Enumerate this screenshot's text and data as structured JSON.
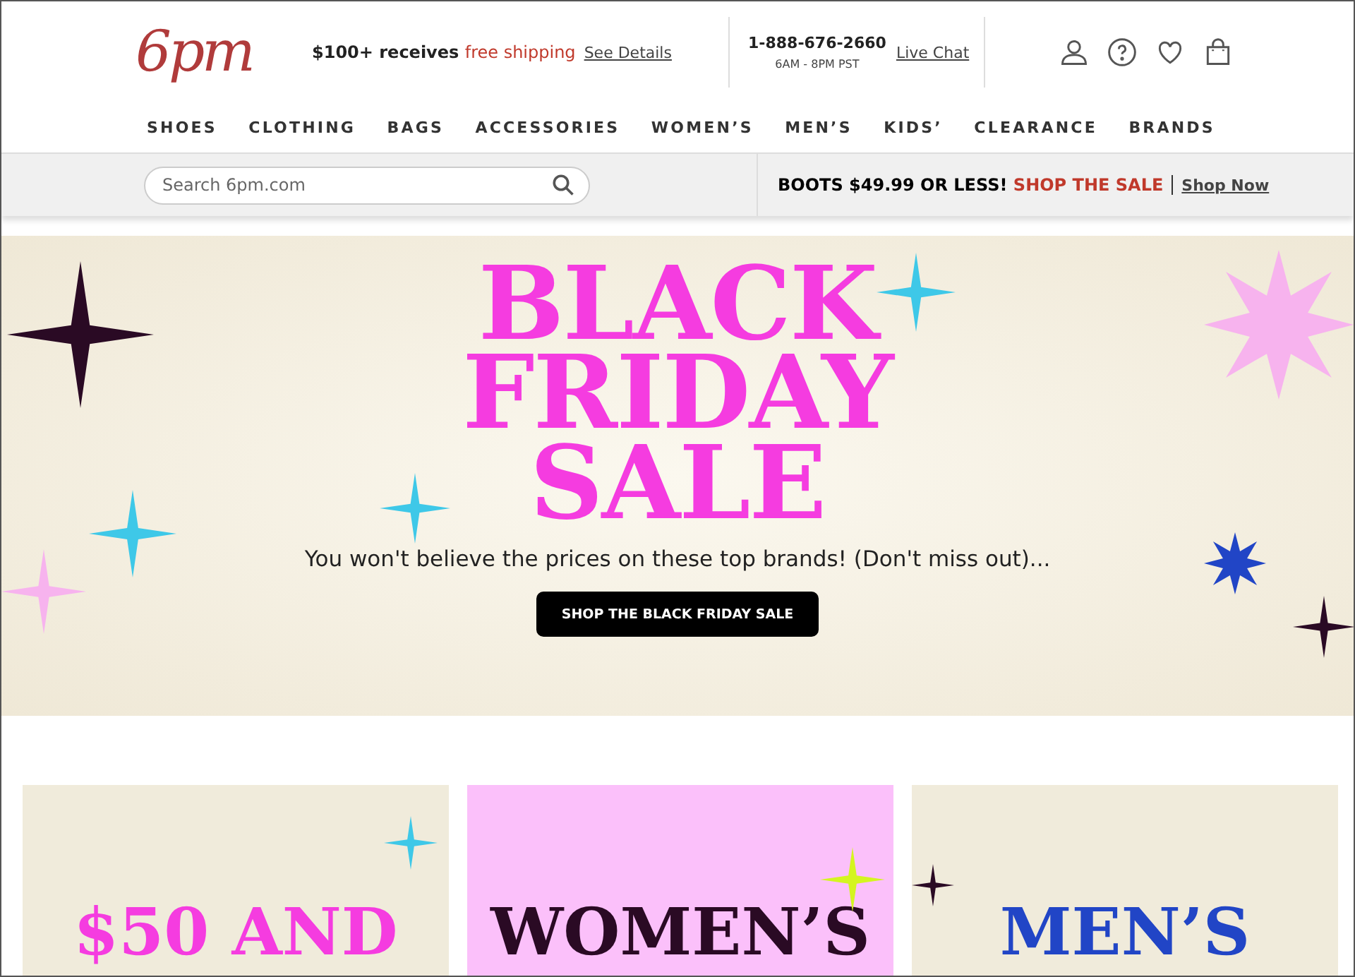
{
  "header": {
    "logo": "6pm",
    "promo": {
      "lead": "$100+ receives",
      "highlight": "free shipping",
      "link": "See Details"
    },
    "phone": "1-888-676-2660",
    "hours": "6AM - 8PM PST",
    "chat": "Live Chat"
  },
  "nav": [
    "SHOES",
    "CLOTHING",
    "BAGS",
    "ACCESSORIES",
    "WOMEN’S",
    "MEN’S",
    "KIDS’",
    "CLEARANCE",
    "BRANDS"
  ],
  "search": {
    "placeholder": "Search 6pm.com"
  },
  "banner": {
    "lead": "BOOTS $49.99 OR LESS!",
    "highlight": "SHOP THE SALE",
    "link": "Shop Now"
  },
  "hero": {
    "title": [
      "BLACK",
      "FRIDAY",
      "SALE"
    ],
    "subtitle": "You won't believe the prices on these top brands! (Don't miss out)...",
    "button": "SHOP THE BLACK FRIDAY SALE"
  },
  "cards": [
    {
      "title": "$50 AND",
      "color": "#f53ce0"
    },
    {
      "title": "WOMEN’S",
      "color": "#2a0a24"
    },
    {
      "title": "MEN’S",
      "color": "#2145c6"
    }
  ]
}
